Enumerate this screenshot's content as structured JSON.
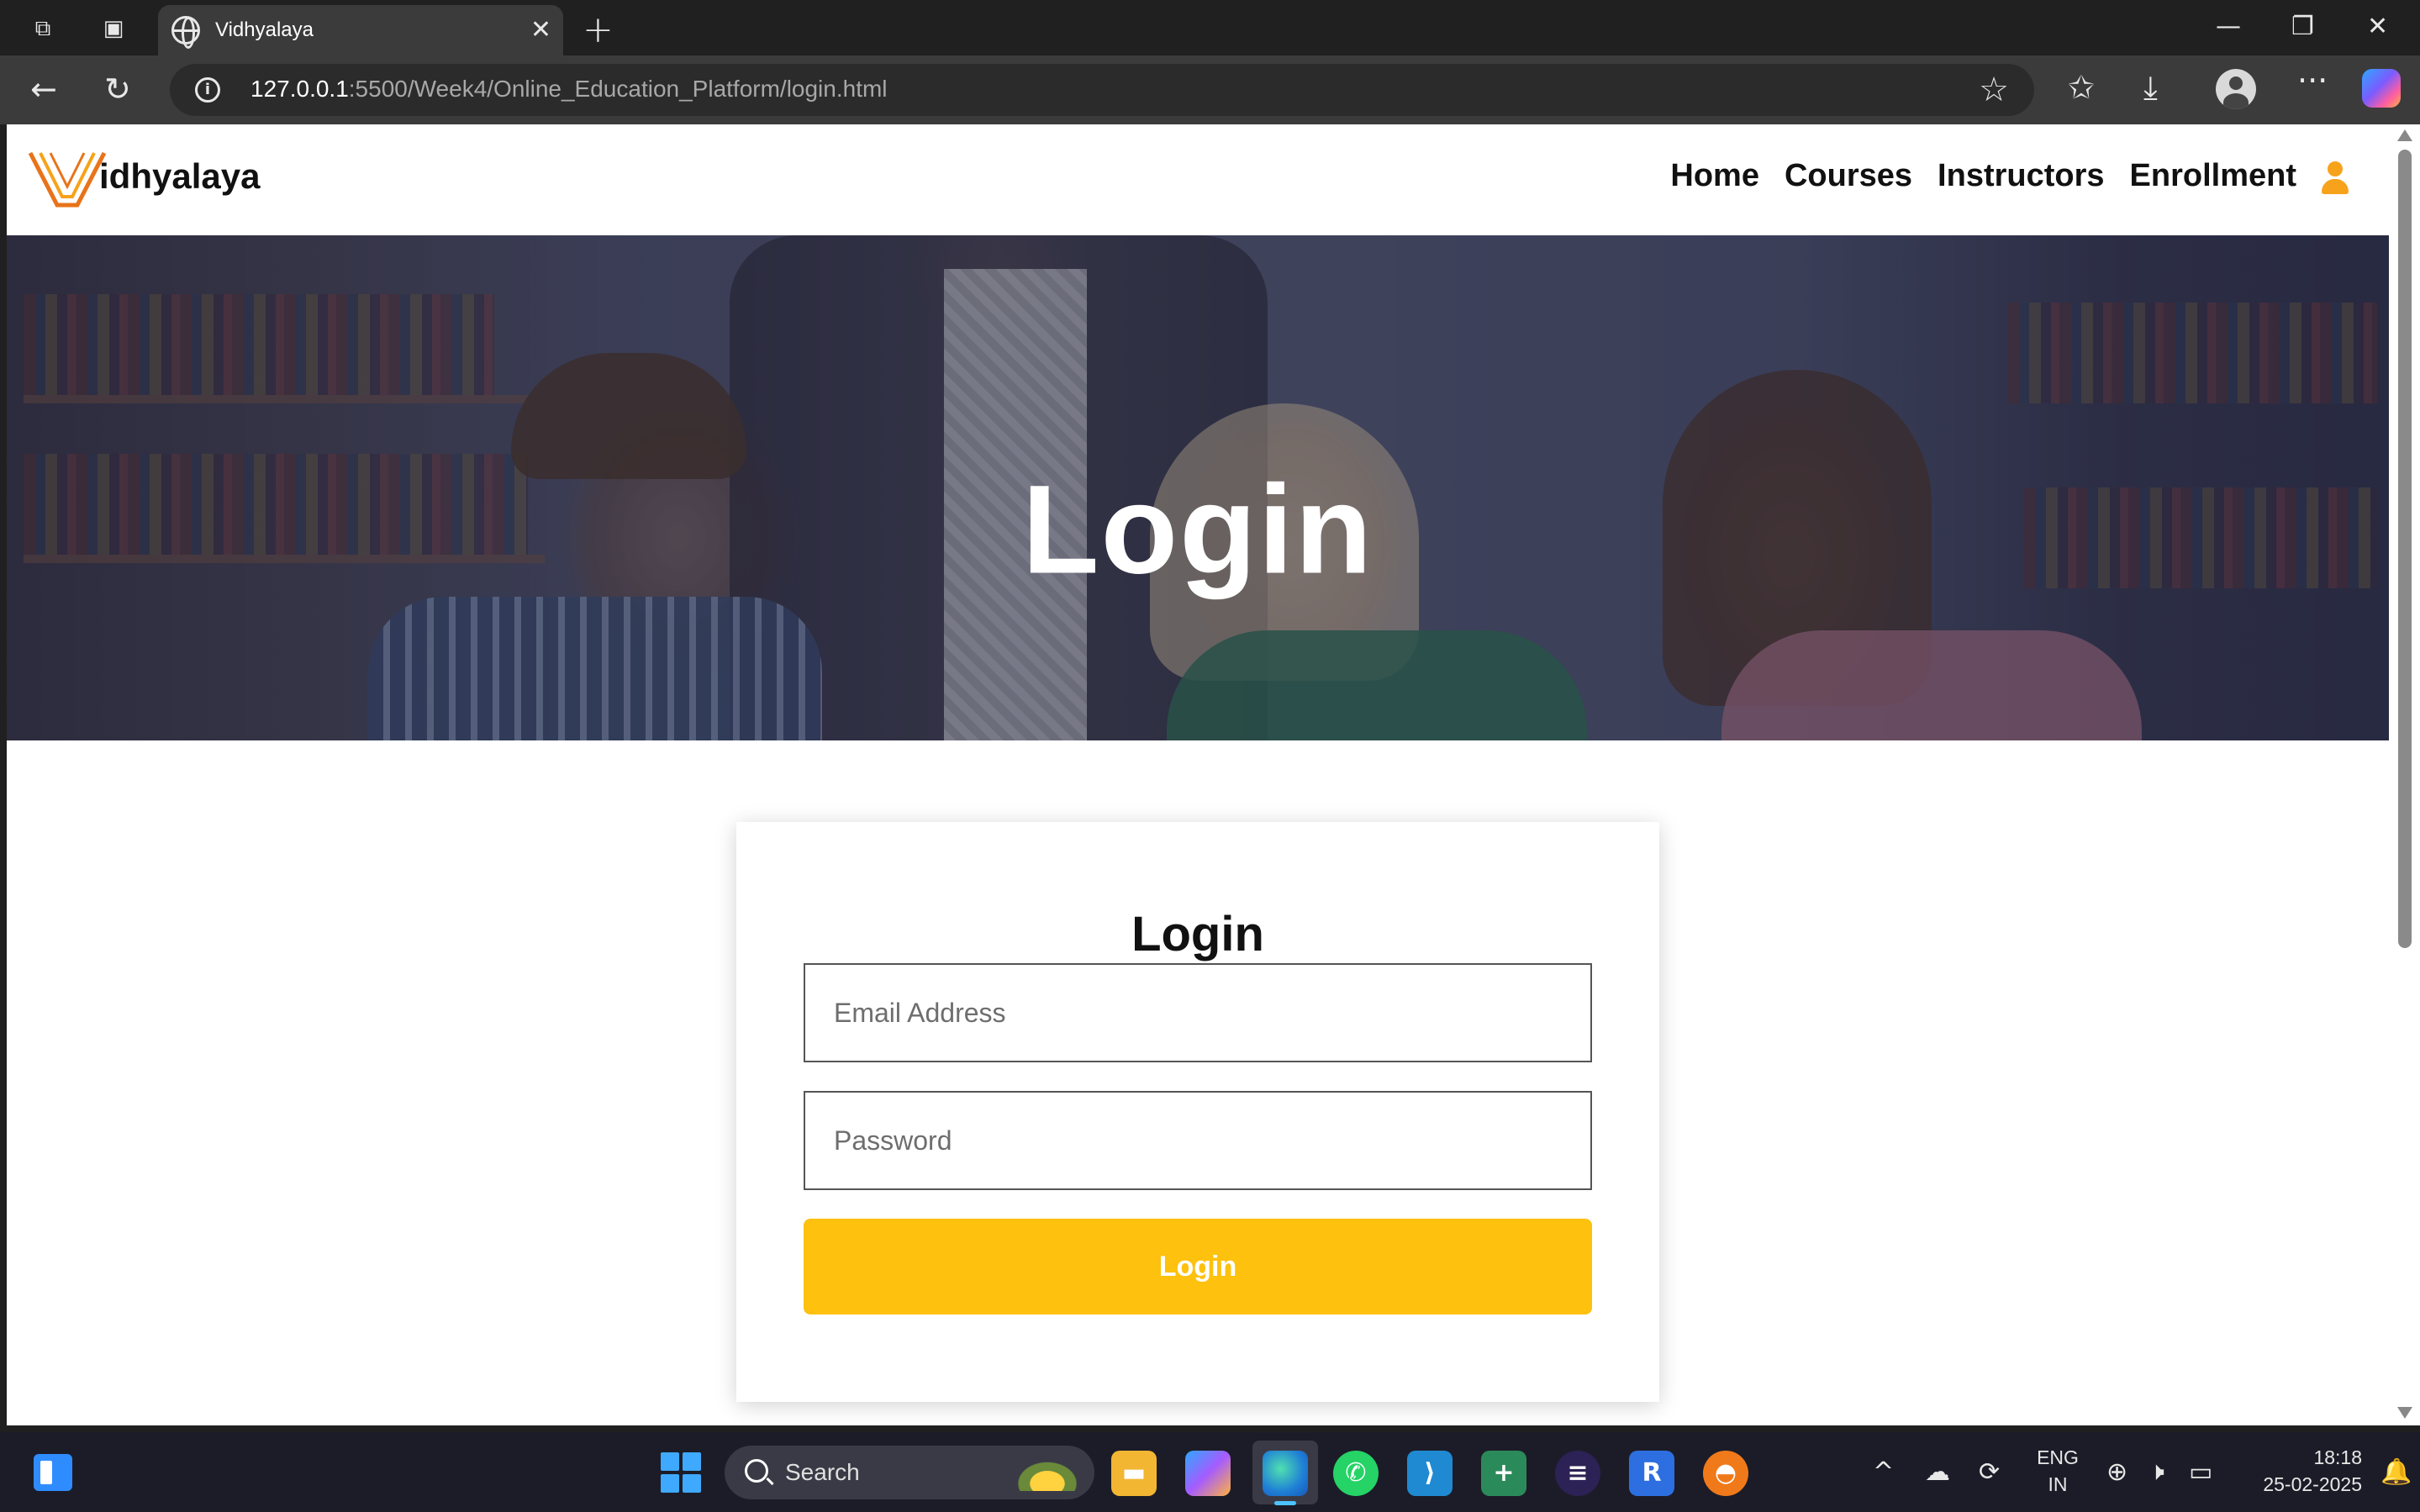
{
  "browser": {
    "tab_title": "Vidhyalaya",
    "url_host": "127.0.0.1",
    "url_rest": ":5500/Week4/Online_Education_Platform/login.html"
  },
  "site": {
    "brand_text": "idhyalaya",
    "brand_accent_color": "#f7a21b",
    "nav": [
      "Home",
      "Courses",
      "Instructors",
      "Enrollment"
    ],
    "user_icon": "user-icon"
  },
  "hero": {
    "title": "Login"
  },
  "form": {
    "title": "Login",
    "email_placeholder": "Email Address",
    "password_placeholder": "Password",
    "submit_label": "Login",
    "submit_color": "#fdc10e"
  },
  "taskbar": {
    "search_label": "Search",
    "lang_line1": "ENG",
    "lang_line2": "IN",
    "time": "18:18",
    "date": "25-02-2025"
  }
}
